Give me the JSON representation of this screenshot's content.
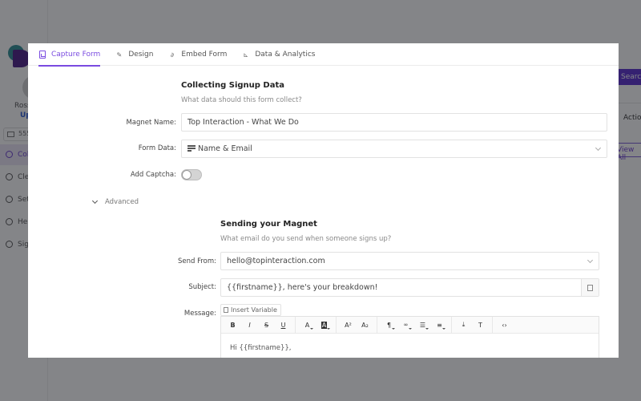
{
  "background": {
    "user_name": "Ross",
    "upgrade_label": "Up",
    "phone_text": "555",
    "nav_items": [
      {
        "label": "Col",
        "icon": "collect-icon",
        "active": true
      },
      {
        "label": "Cle",
        "icon": "bell-icon",
        "active": false
      },
      {
        "label": "Set",
        "icon": "gear-icon",
        "active": false
      },
      {
        "label": "Hel",
        "icon": "help-icon",
        "active": false
      },
      {
        "label": "Sig",
        "icon": "sign-out-icon",
        "active": false
      }
    ],
    "search_label": "Search",
    "action_header": "Action",
    "view_all_label": "View All"
  },
  "modal": {
    "tabs": [
      {
        "label": "Capture Form",
        "icon": "form-icon",
        "active": true
      },
      {
        "label": "Design",
        "icon": "brush-icon",
        "active": false
      },
      {
        "label": "Embed Form",
        "icon": "link-icon",
        "active": false
      },
      {
        "label": "Data & Analytics",
        "icon": "chart-icon",
        "active": false
      }
    ],
    "collecting": {
      "title": "Collecting Signup Data",
      "subtitle": "What data should this form collect?",
      "magnet_name_label": "Magnet Name:",
      "magnet_name_value": "Top Interaction - What We Do",
      "form_data_label": "Form Data:",
      "form_data_value": "Name & Email",
      "captcha_label": "Add Captcha:",
      "captcha_enabled": false
    },
    "advanced_label": "Advanced",
    "sending": {
      "title": "Sending your Magnet",
      "subtitle": "What email do you send when someone signs up?",
      "send_from_label": "Send From:",
      "send_from_value": "hello@topinteraction.com",
      "subject_label": "Subject:",
      "subject_value": "{{firstname}}, here's your breakdown!",
      "message_label": "Message:",
      "insert_variable_label": "Insert Variable",
      "toolbar": {
        "bold": "B",
        "italic": "I",
        "strike": "S",
        "underline": "U",
        "font_color": "A",
        "highlight": "A",
        "superscript": "A²",
        "subscript": "A₂",
        "paragraph": "¶",
        "link": "🔗",
        "list": "☰",
        "align": "≡",
        "insert": "⤓",
        "clear_format": "T",
        "code": "‹›"
      },
      "message_body": "Hi  {{firstname}},"
    }
  }
}
